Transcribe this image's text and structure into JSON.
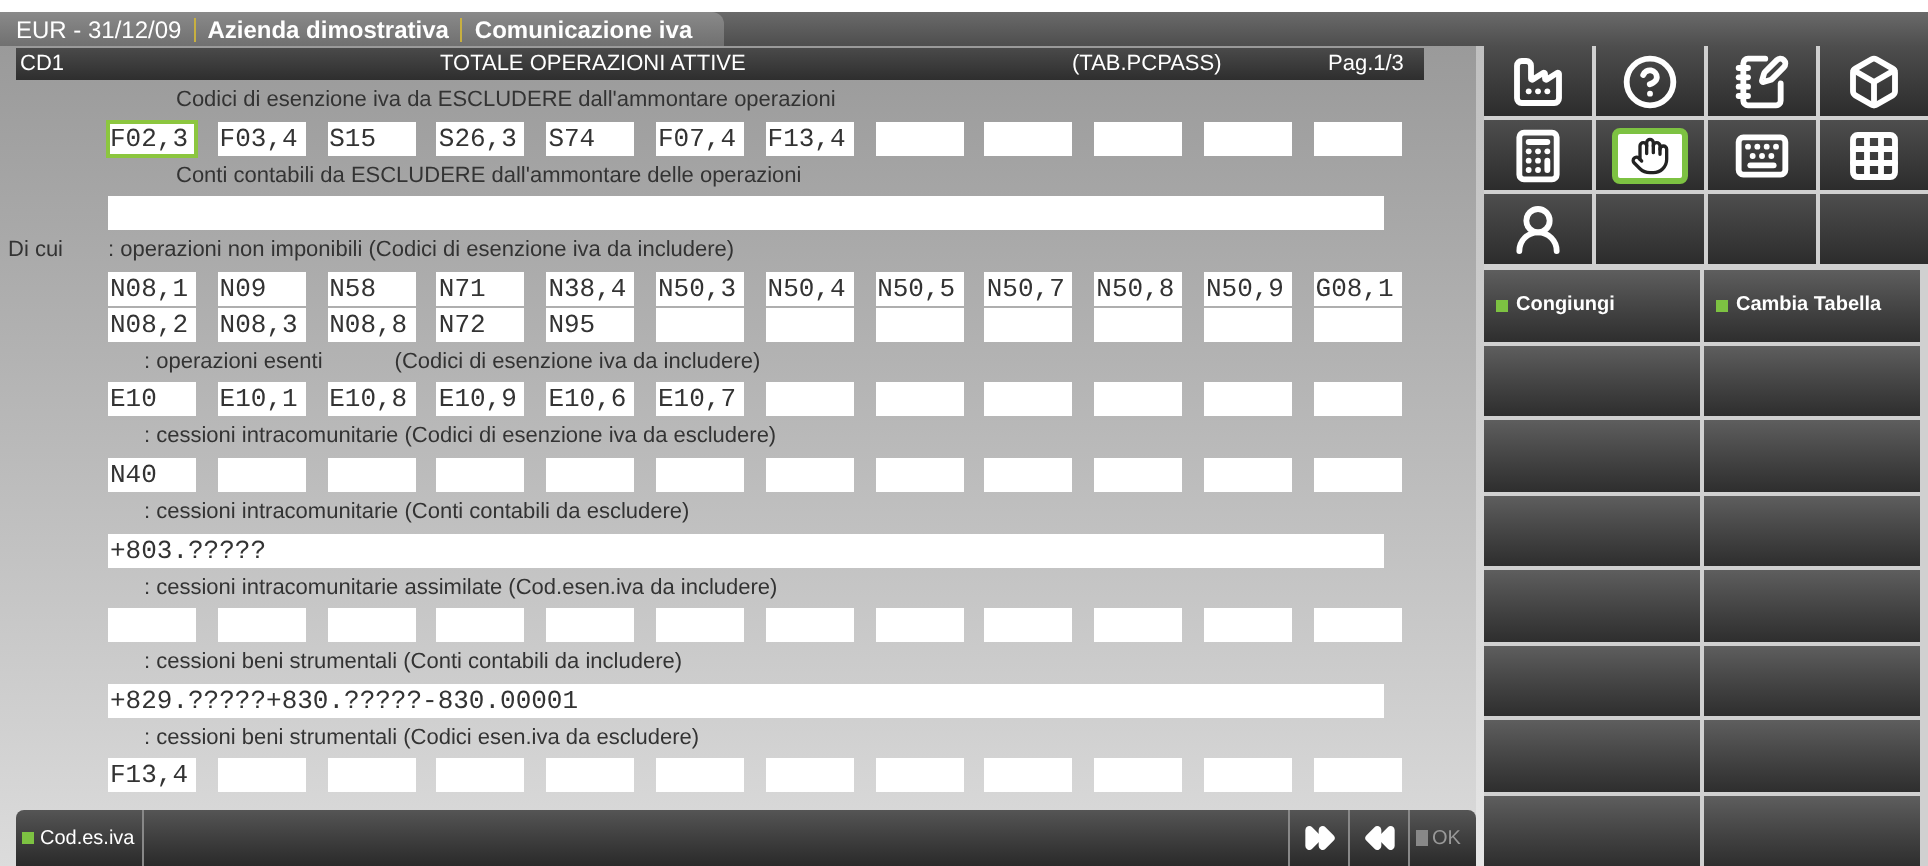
{
  "tab": {
    "parts": [
      "EUR - 31/12/09",
      "Azienda dimostrativa",
      "Comunicazione iva"
    ]
  },
  "header": {
    "code": "CD1",
    "title": "TOTALE OPERAZIONI ATTIVE",
    "table": "(TAB.PCPASS)",
    "page": "Pag.1/3"
  },
  "sections": [
    {
      "label": "Codici di esenzione iva da ESCLUDERE dall'ammontare operazioni",
      "kind": "codes",
      "rows": [
        [
          {
            "value": "F02,3",
            "focused": true
          },
          {
            "value": "F03,4",
            "focused": false
          },
          {
            "value": "S15",
            "focused": false
          },
          {
            "value": "S26,3",
            "focused": false
          },
          {
            "value": "S74",
            "focused": false
          },
          {
            "value": "F07,4",
            "focused": false
          },
          {
            "value": "F13,4",
            "focused": false
          },
          {
            "focused": false
          },
          {
            "focused": false
          },
          {
            "focused": false
          },
          {
            "focused": false
          },
          {
            "focused": false
          }
        ]
      ]
    },
    {
      "label": "Conti contabili da ESCLUDERE dall'ammontare delle operazioni",
      "kind": "accounts",
      "field": {
        "focused": false
      }
    },
    {
      "lead": "Di cui",
      "label": ": operazioni non imponibili (Codici di esenzione iva da includere)",
      "kind": "codes",
      "rows": [
        [
          {
            "value": "N08,1",
            "focused": false
          },
          {
            "value": "N09",
            "focused": false
          },
          {
            "value": "N58",
            "focused": false
          },
          {
            "value": "N71",
            "focused": false
          },
          {
            "value": "N38,4",
            "focused": false
          },
          {
            "value": "N50,3",
            "focused": false
          },
          {
            "value": "N50,4",
            "focused": false
          },
          {
            "value": "N50,5",
            "focused": false
          },
          {
            "value": "N50,7",
            "focused": false
          },
          {
            "value": "N50,8",
            "focused": false
          },
          {
            "value": "N50,9",
            "focused": false
          },
          {
            "value": "G08,1",
            "focused": false
          }
        ],
        [
          {
            "value": "N08,2",
            "focused": false
          },
          {
            "value": "N08,3",
            "focused": false
          },
          {
            "value": "N08,8",
            "focused": false
          },
          {
            "value": "N72",
            "focused": false
          },
          {
            "value": "N95",
            "focused": false
          },
          {
            "focused": false
          },
          {
            "focused": false
          },
          {
            "focused": false
          },
          {
            "focused": false
          },
          {
            "focused": false
          },
          {
            "focused": false
          },
          {
            "focused": false
          }
        ]
      ]
    },
    {
      "label": ": operazioni esenti",
      "note": "(Codici di esenzione iva da includere)",
      "kind": "codes",
      "rows": [
        [
          {
            "value": "E10",
            "focused": false
          },
          {
            "value": "E10,1",
            "focused": false
          },
          {
            "value": "E10,8",
            "focused": false
          },
          {
            "value": "E10,9",
            "focused": false
          },
          {
            "value": "E10,6",
            "focused": false
          },
          {
            "value": "E10,7",
            "focused": false
          },
          {
            "focused": false
          },
          {
            "focused": false
          },
          {
            "focused": false
          },
          {
            "focused": false
          },
          {
            "focused": false
          },
          {
            "focused": false
          }
        ]
      ]
    },
    {
      "label": ": cessioni intracomunitarie (Codici di esenzione iva da escludere)",
      "kind": "codes",
      "rows": [
        [
          {
            "value": "N40",
            "focused": false
          },
          {
            "focused": false
          },
          {
            "focused": false
          },
          {
            "focused": false
          },
          {
            "focused": false
          },
          {
            "focused": false
          },
          {
            "focused": false
          },
          {
            "focused": false
          },
          {
            "focused": false
          },
          {
            "focused": false
          },
          {
            "focused": false
          },
          {
            "focused": false
          }
        ]
      ]
    },
    {
      "label": ": cessioni intracomunitarie (Conti contabili da escludere)",
      "kind": "accounts",
      "field": {
        "value": "+803.?????",
        "focused": false
      }
    },
    {
      "label": ": cessioni intracomunitarie assimilate (Cod.esen.iva da includere)",
      "kind": "codes",
      "rows": [
        [
          {
            "focused": false
          },
          {
            "focused": false
          },
          {
            "focused": false
          },
          {
            "focused": false
          },
          {
            "focused": false
          },
          {
            "focused": false
          },
          {
            "focused": false
          },
          {
            "focused": false
          },
          {
            "focused": false
          },
          {
            "focused": false
          },
          {
            "focused": false
          },
          {
            "focused": false
          }
        ]
      ]
    },
    {
      "label": ": cessioni beni strumentali (Conti contabili da includere)",
      "kind": "accounts",
      "field": {
        "value": "+829.?????+830.?????-830.00001",
        "focused": false
      }
    },
    {
      "label": ": cessioni beni strumentali (Codici esen.iva da escludere)",
      "kind": "codes",
      "rows": [
        [
          {
            "value": "F13,4",
            "focused": false
          },
          {
            "focused": false
          },
          {
            "focused": false
          },
          {
            "focused": false
          },
          {
            "focused": false
          },
          {
            "focused": false
          },
          {
            "focused": false
          },
          {
            "focused": false
          },
          {
            "focused": false
          },
          {
            "focused": false
          },
          {
            "focused": false
          },
          {
            "focused": false
          }
        ]
      ]
    }
  ],
  "tools": [
    {
      "selected": false
    },
    {
      "selected": false
    },
    {
      "selected": false
    },
    {
      "selected": false
    },
    {
      "selected": false
    },
    {
      "selected": true
    },
    {
      "selected": false
    },
    {
      "selected": false
    },
    {
      "selected": false
    }
  ],
  "function_buttons": [
    {
      "label": "Congiungi"
    },
    {
      "label": "Cambia Tabella"
    }
  ],
  "bottom_bar": {
    "key_button": "Cod.es.iva",
    "ok": {
      "label": "OK",
      "disabled": true
    }
  }
}
